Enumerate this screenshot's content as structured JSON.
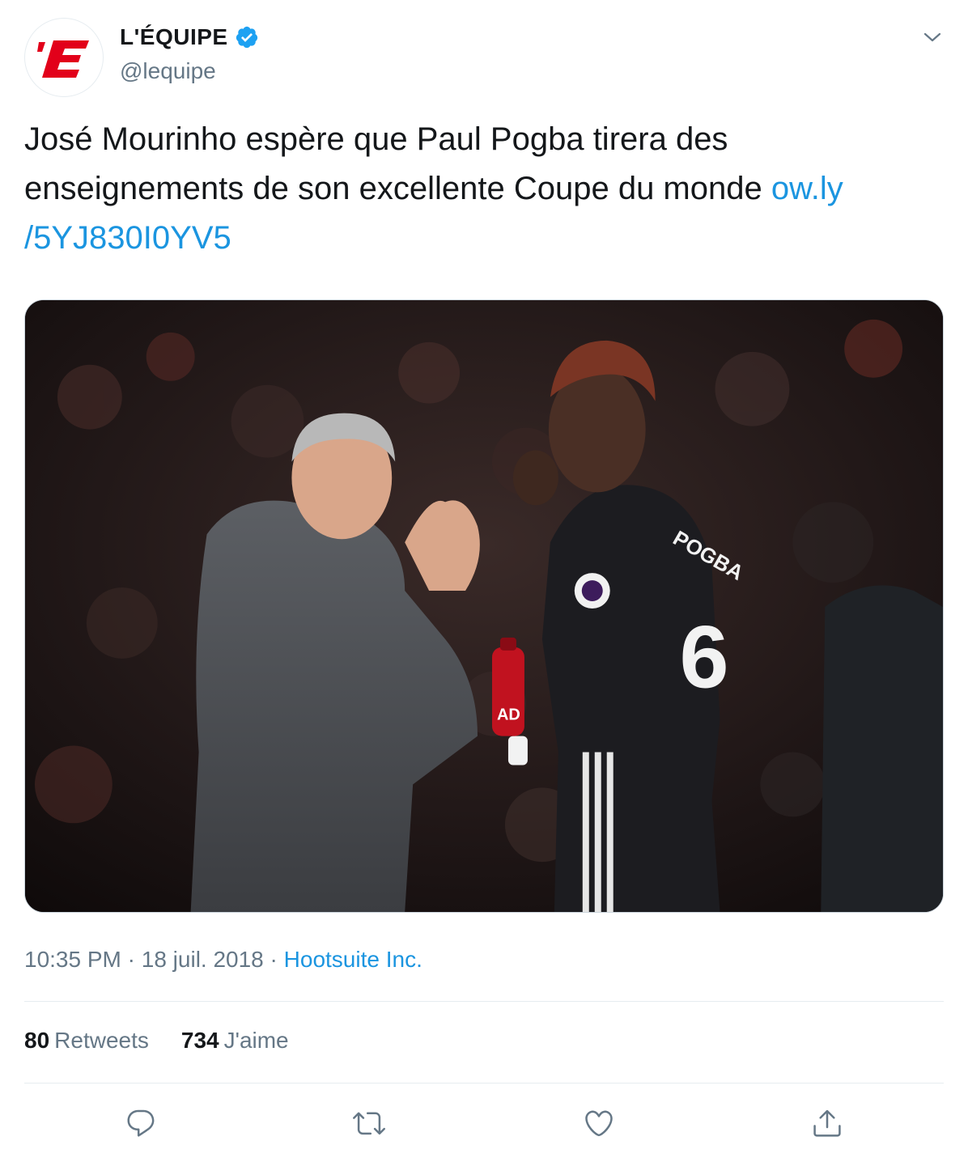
{
  "account": {
    "display_name": "L'ÉQUIPE",
    "handle": "@lequipe",
    "avatar_icon": "lequipe-logo",
    "avatar_logo_text": "'E",
    "verified_icon": "verified-badge-icon",
    "brand_color": "#e2001a"
  },
  "tweet": {
    "text": "José Mourinho espère que Paul Pogba tirera des enseignements de son excellente Coupe du monde ",
    "link_line1": "ow.ly",
    "link_line2": "/5YJ830I0YV5",
    "link_color": "#1b95e0"
  },
  "media": {
    "player_name": "POGBA",
    "player_number": "6",
    "bottle_text": "AD"
  },
  "meta": {
    "time": "10:35 PM",
    "date": "18 juil. 2018",
    "separator": "·",
    "source": "Hootsuite Inc."
  },
  "stats": {
    "retweets_count": "80",
    "retweets_label": "Retweets",
    "likes_count": "734",
    "likes_label": "J'aime"
  },
  "actions": {
    "reply_icon": "reply-icon",
    "retweet_icon": "retweet-icon",
    "like_icon": "heart-icon",
    "share_icon": "share-icon",
    "menu_icon": "chevron-down-icon"
  }
}
